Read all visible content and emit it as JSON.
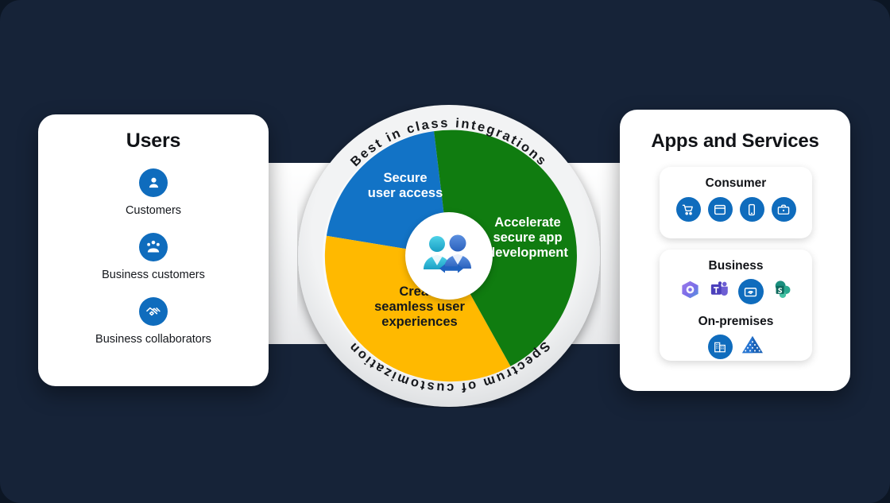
{
  "theme": {
    "background": "#162338",
    "panel_bg": "#ffffff",
    "accent_blue": "#0f6cbd",
    "segment_blue": "#1273c6",
    "segment_green": "#107c10",
    "segment_yellow": "#ffb900",
    "ring_gray": "#e9eaec",
    "text_dark": "#14181d",
    "text_light": "#ffffff"
  },
  "users_panel": {
    "title": "Users",
    "items": [
      {
        "label": "Customers",
        "icon": "person-icon"
      },
      {
        "label": "Business customers",
        "icon": "people-group-icon"
      },
      {
        "label": "Business collaborators",
        "icon": "handshake-icon"
      }
    ]
  },
  "apps_panel": {
    "title": "Apps and Services",
    "groups": [
      {
        "title": "Consumer",
        "icons": [
          {
            "name": "shopping-cart-icon"
          },
          {
            "name": "browser-window-icon"
          },
          {
            "name": "mobile-phone-icon"
          },
          {
            "name": "briefcase-icon"
          }
        ]
      },
      {
        "title": "Business",
        "icons": [
          {
            "name": "microsoft-365-icon"
          },
          {
            "name": "microsoft-teams-icon"
          },
          {
            "name": "line-of-business-app-icon"
          },
          {
            "name": "sharepoint-icon"
          }
        ],
        "subgroup": {
          "title": "On-premises",
          "icons": [
            {
              "name": "office-building-icon"
            },
            {
              "name": "active-directory-icon"
            }
          ]
        }
      }
    ]
  },
  "wheel": {
    "arc_top": "Best in class integrations",
    "arc_bottom": "Spectrum of customization",
    "hub_icon": "two-users-exchange-icon",
    "segments": [
      {
        "id": "secure-user-access",
        "label": "Secure\nuser access",
        "line1": "Secure",
        "line2": "user access",
        "line3": "",
        "color": "#1273c6"
      },
      {
        "id": "accelerate-app-dev",
        "label": "Accelerate secure app development",
        "line1": "Accelerate",
        "line2": "secure app",
        "line3": "development",
        "color": "#107c10"
      },
      {
        "id": "seamless-experiences",
        "label": "Create seamless user experiences",
        "line1": "Create",
        "line2": "seamless user",
        "line3": "experiences",
        "color": "#ffb900"
      }
    ]
  }
}
